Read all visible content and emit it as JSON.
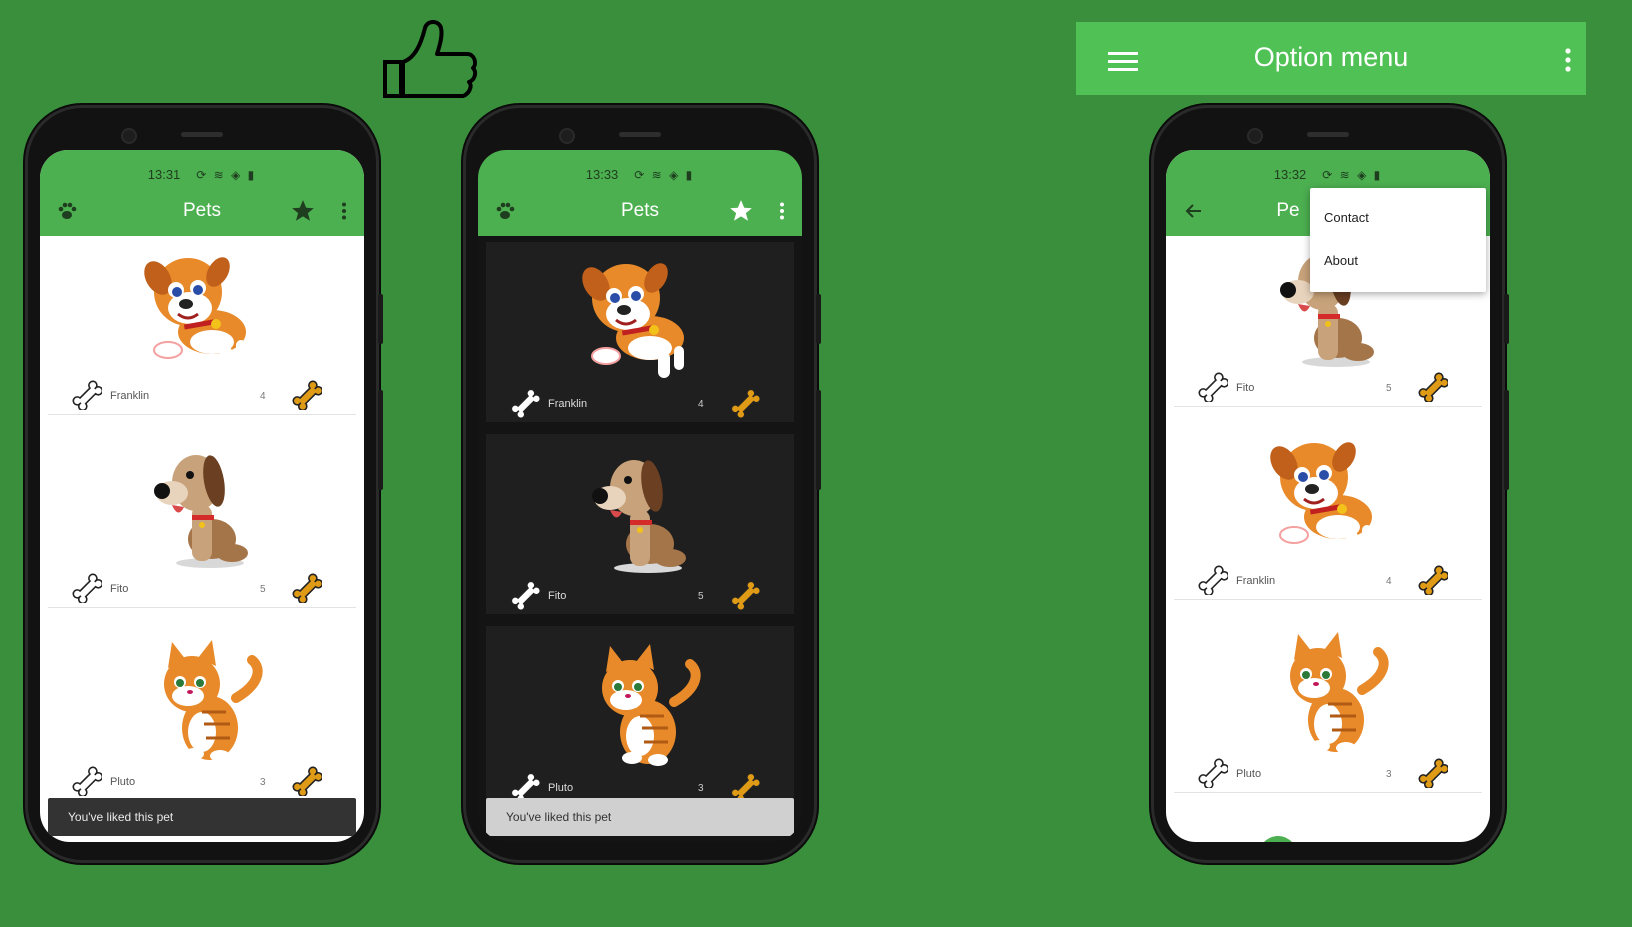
{
  "thumb_icon": "thumbs-up-icon",
  "option_menu_bar": {
    "title": "Option menu",
    "leading_icon": "hamburger-menu-icon",
    "trailing_icon": "overflow-menu-icon",
    "color": "#50c155"
  },
  "background_color": "#3a8f3d",
  "phones": [
    {
      "theme": "light",
      "status_time": "13:31",
      "appbar": {
        "title": "Pets",
        "leading_icon": "paw-icon",
        "action_icon": "star-icon"
      },
      "pets": [
        {
          "name": "Franklin",
          "likes": "4",
          "image": "orange-puppy"
        },
        {
          "name": "Fito",
          "likes": "5",
          "image": "brown-dog"
        },
        {
          "name": "Pluto",
          "likes": "3",
          "image": "orange-cat"
        }
      ],
      "snackbar": "You've liked this pet"
    },
    {
      "theme": "dark",
      "status_time": "13:33",
      "appbar": {
        "title": "Pets",
        "leading_icon": "paw-icon",
        "action_icon": "star-icon"
      },
      "pets": [
        {
          "name": "Franklin",
          "likes": "4",
          "image": "orange-puppy"
        },
        {
          "name": "Fito",
          "likes": "5",
          "image": "brown-dog"
        },
        {
          "name": "Pluto",
          "likes": "3",
          "image": "orange-cat"
        }
      ],
      "snackbar": "You've liked this pet"
    },
    {
      "theme": "light",
      "status_time": "13:32",
      "appbar": {
        "title": "Pe",
        "leading_icon": "back-arrow-icon"
      },
      "popup_menu": [
        "Contact",
        "About"
      ],
      "pets": [
        {
          "name": "Fito",
          "likes": "5",
          "image": "brown-dog"
        },
        {
          "name": "Franklin",
          "likes": "4",
          "image": "orange-puppy"
        },
        {
          "name": "Pluto",
          "likes": "3",
          "image": "orange-cat"
        }
      ]
    }
  ],
  "colors": {
    "appbar_green": "#4caf50",
    "bone_filled": "#e09b16",
    "snackbar_light": "#333333",
    "snackbar_dark": "#d0d0d0"
  }
}
